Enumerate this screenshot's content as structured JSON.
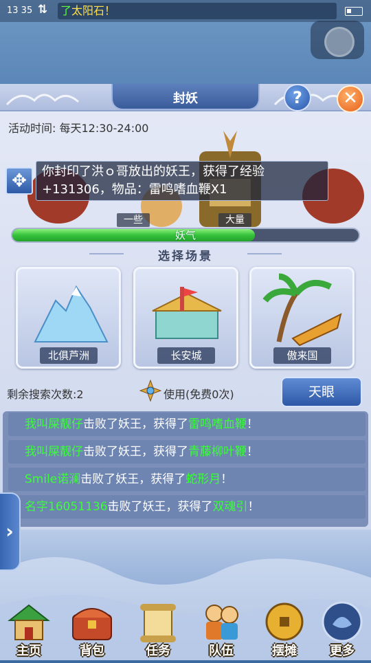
{
  "status_bar": {
    "time": "13 35",
    "arrows": "⇅",
    "ticker_prefix": "了",
    "ticker_text": "太阳石！"
  },
  "panel": {
    "title": "封妖",
    "help_label": "?",
    "close_label": "✕",
    "activity_time": "活动时间: 每天12:30-24:00",
    "notification": "你封印了洪ｏ哥放出的妖王，获得了经验+131306，物品：雷鸣嗜血鞭X1",
    "move_icon": "✥",
    "gauge": {
      "left_label": "一些",
      "right_label": "大量",
      "bar_label": "妖气",
      "fill_fraction": 0.7
    },
    "scene_section_title": "选择场景",
    "scenes": [
      {
        "label": "北俱芦洲"
      },
      {
        "label": "长安城"
      },
      {
        "label": "傲来国"
      }
    ],
    "remaining_searches": "剩余搜索次数:2",
    "use_free": "使用(免费0次)",
    "sky_eye_button": "天眼",
    "log": [
      {
        "player": "我叫屎靓仔",
        "middle": "击败了妖王，获得了",
        "item": "雷鸣嗜血鞭",
        "end": "！"
      },
      {
        "player": "我叫屎靓仔",
        "middle": "击败了妖王，获得了",
        "item": "青藤柳叶鞭",
        "end": "！"
      },
      {
        "player": "Smile诺澜",
        "middle": "击败了妖王，获得了",
        "item": "蛇形月",
        "end": "！"
      },
      {
        "player": "名字16051136",
        "middle": "击败了妖王，获得了",
        "item": "双魂引",
        "end": "！"
      }
    ],
    "side_arrow": "›"
  },
  "bottom_nav": [
    {
      "label": "主页",
      "icon": "house-icon"
    },
    {
      "label": "背包",
      "icon": "chest-icon"
    },
    {
      "label": "任务",
      "icon": "scroll-icon"
    },
    {
      "label": "队伍",
      "icon": "team-icon"
    },
    {
      "label": "摆摊",
      "icon": "coin-icon"
    },
    {
      "label": "更多",
      "icon": "more-orb-icon"
    }
  ],
  "colors": {
    "gauge_green": "#35c23b",
    "highlight_green": "#3bff38",
    "ticker_yellow": "#ffe04a"
  }
}
